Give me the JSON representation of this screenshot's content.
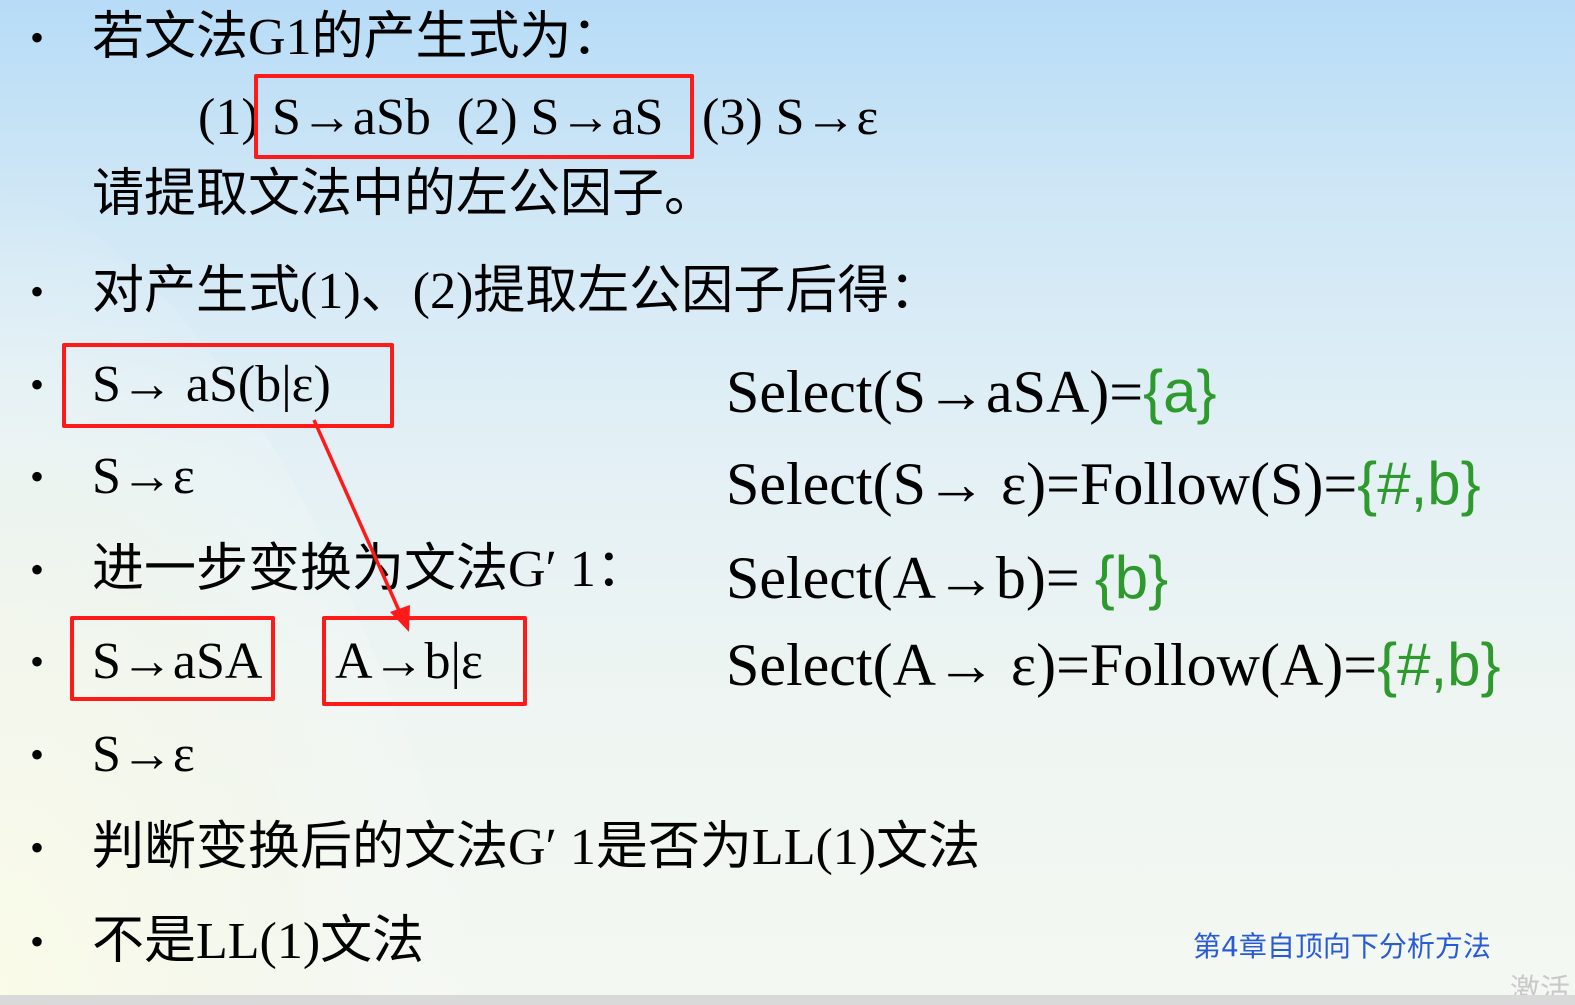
{
  "lines": {
    "l1": "若文法G1的产生式为：",
    "l2_p1": "(1)",
    "l2_boxed": "S→aSb  (2) S→aS",
    "l2_p3": "(3) S→ε",
    "l3": "请提取文法中的左公因子。",
    "l4": "对产生式(1)、(2)提取左公因子后得：",
    "l5": "S→ aS(b|ε)",
    "l6": "S→ε",
    "l7": "进一步变换为文法G′ 1：",
    "l8a": "S→aSA",
    "l8b": "A→b|ε",
    "l9": "S→ε",
    "l10": "判断变换后的文法G′ 1是否为LL(1)文法",
    "l11": "不是LL(1)文法"
  },
  "bullet_char": "•",
  "select": [
    {
      "expr": "Select(S→aSA)=",
      "set": "{a}"
    },
    {
      "expr": "Select(S→ ε)=Follow(S)=",
      "set": "{#,b}"
    },
    {
      "expr": "Select(A→b)= ",
      "set": "{b}"
    },
    {
      "expr": "Select(A→ ε)=Follow(A)=",
      "set": "{#,b}"
    }
  ],
  "footer": "第4章自顶向下分析方法",
  "watermark": "激活",
  "colors": {
    "highlight_box": "#ff1a1a",
    "set_text": "#2e9a2e",
    "footer_text": "#2a5bd7"
  }
}
